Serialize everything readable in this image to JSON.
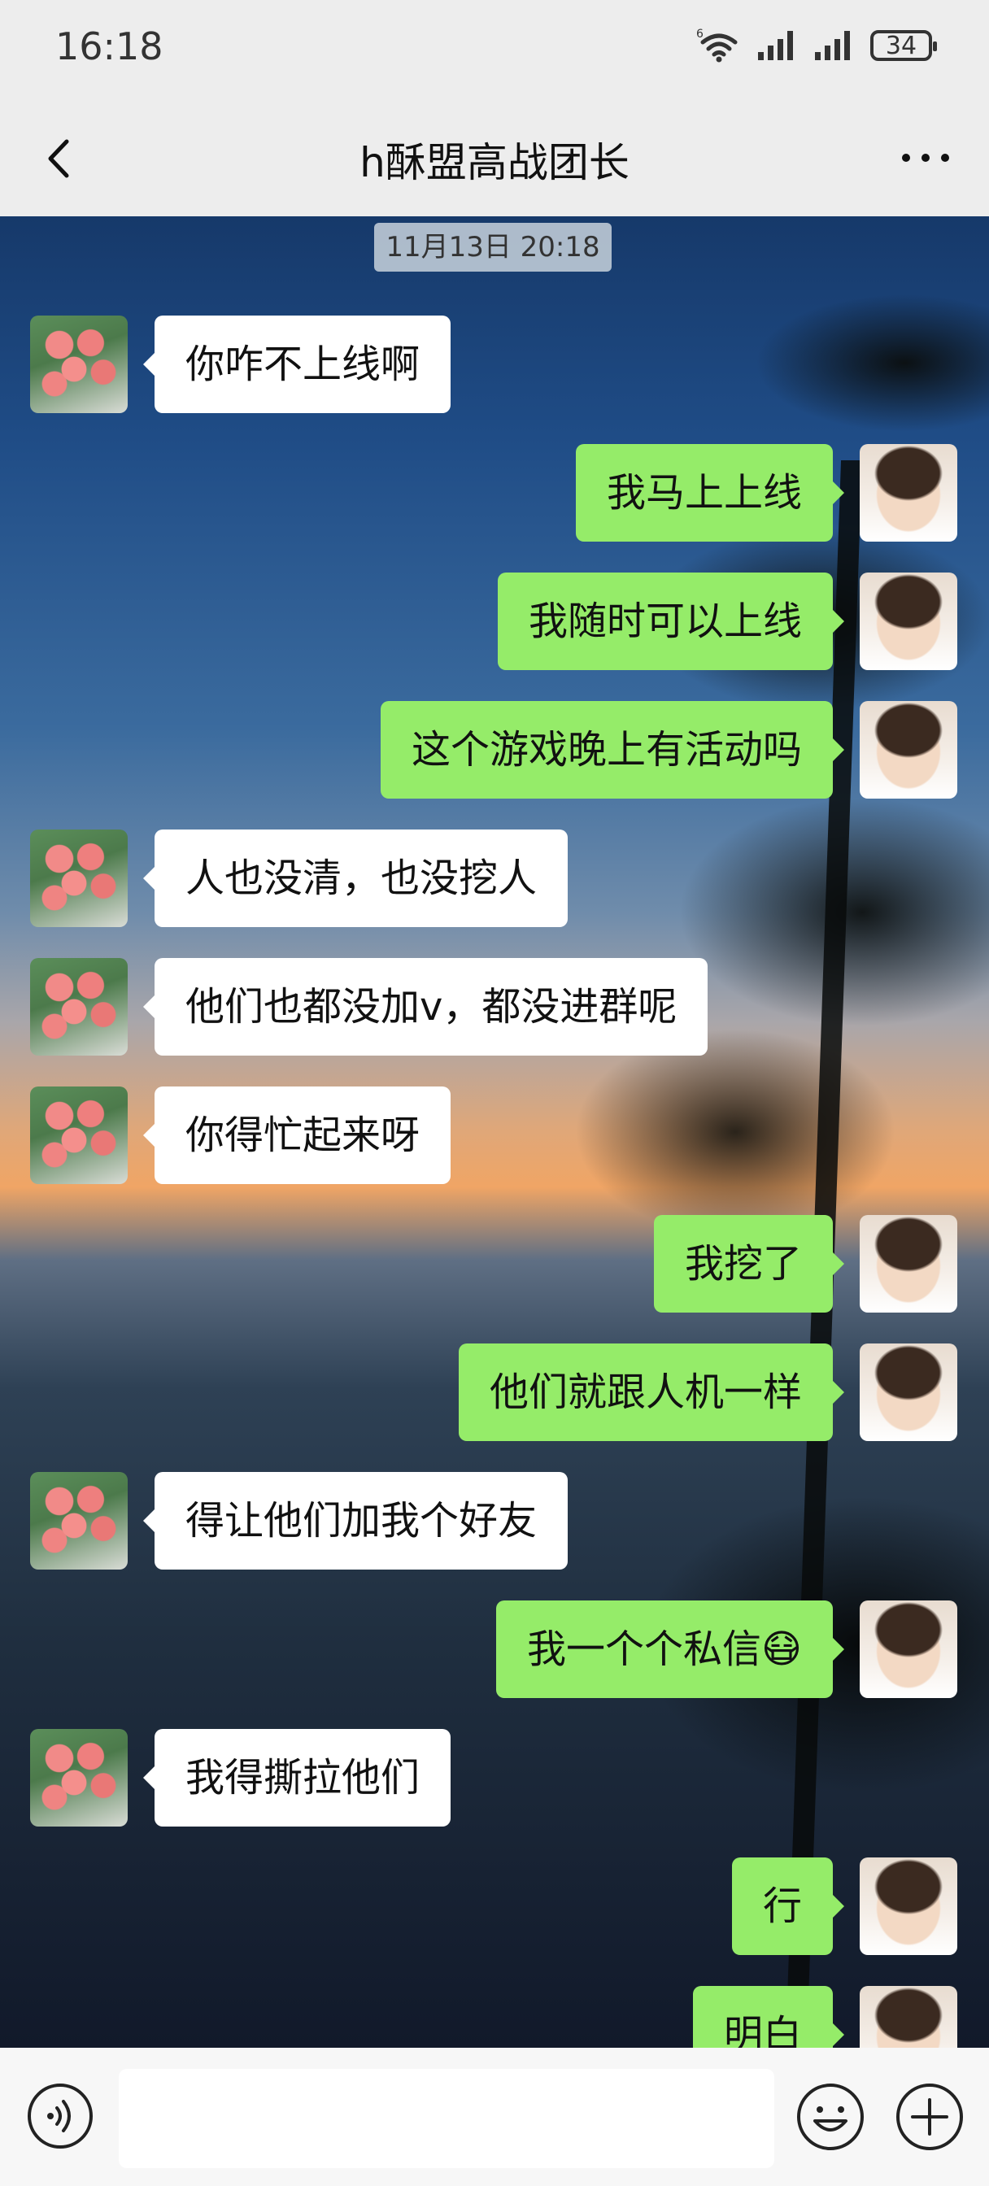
{
  "status_bar": {
    "time": "16:18",
    "battery": "34",
    "network": "6"
  },
  "nav": {
    "title": "h酥盟高战团长"
  },
  "chat": {
    "timestamp": "11月13日 20:18",
    "messages": [
      {
        "side": "left",
        "text": "你咋不上线啊"
      },
      {
        "side": "right",
        "text": "我马上上线"
      },
      {
        "side": "right",
        "text": "我随时可以上线"
      },
      {
        "side": "right",
        "text": "这个游戏晚上有活动吗"
      },
      {
        "side": "left",
        "text": "人也没清，也没挖人"
      },
      {
        "side": "left",
        "text": "他们也都没加v，都没进群呢"
      },
      {
        "side": "left",
        "text": "你得忙起来呀"
      },
      {
        "side": "right",
        "text": "我挖了"
      },
      {
        "side": "right",
        "text": "他们就跟人机一样"
      },
      {
        "side": "left",
        "text": "得让他们加我个好友"
      },
      {
        "side": "right",
        "text": "我一个个私信😷"
      },
      {
        "side": "left",
        "text": "我得撕拉他们"
      },
      {
        "side": "right",
        "text": "行"
      },
      {
        "side": "right",
        "text": "明白"
      }
    ]
  },
  "colors": {
    "bubble_self": "#95ec69",
    "bubble_other": "#ffffff",
    "bar_bg": "#ededed"
  },
  "icons": {
    "back": "chevron-left-icon",
    "more": "more-dots-icon",
    "voice": "voice-icon",
    "emoji": "emoji-icon",
    "plus": "plus-icon"
  }
}
